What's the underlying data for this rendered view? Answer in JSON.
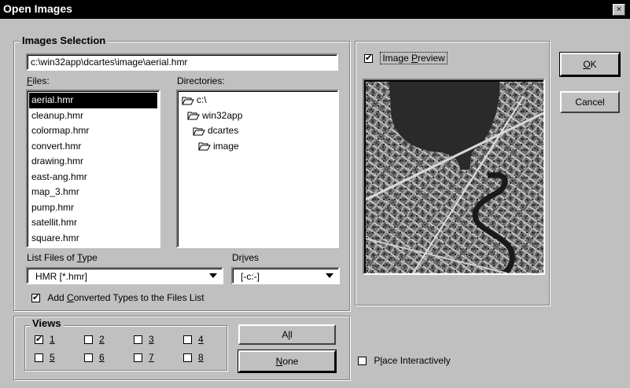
{
  "window": {
    "title": "Open Images",
    "close_glyph": "×"
  },
  "images_selection": {
    "legend": "Images Selection",
    "path_value": "c:\\win32app\\dcartes\\image\\aerial.hmr",
    "files_label": "Files:",
    "directories_label": "Directories:",
    "files": [
      "aerial.hmr",
      "cleanup.hmr",
      "colormap.hmr",
      "convert.hmr",
      "drawing.hmr",
      "east-ang.hmr",
      "map_3.hmr",
      "pump.hmr",
      "satellit.hmr",
      "square.hmr"
    ],
    "selected_file": "aerial.hmr",
    "directories": [
      "c:\\",
      "win32app",
      "dcartes",
      "image"
    ],
    "list_type_label": "List Files of Type",
    "list_type_value": "HMR [*.hmr]",
    "drives_label": "Drives",
    "drives_value": "[-c:-]",
    "add_converted_label": "Add Converted Types to the Files List",
    "add_converted_checked": true
  },
  "preview": {
    "label": "Image Preview",
    "checked": true
  },
  "buttons": {
    "ok": "OK",
    "cancel": "Cancel",
    "all": "All",
    "none": "None"
  },
  "views": {
    "legend": "Views",
    "items": [
      {
        "label": "1",
        "checked": true
      },
      {
        "label": "2",
        "checked": false
      },
      {
        "label": "3",
        "checked": false
      },
      {
        "label": "4",
        "checked": false
      },
      {
        "label": "5",
        "checked": false
      },
      {
        "label": "6",
        "checked": false
      },
      {
        "label": "7",
        "checked": false
      },
      {
        "label": "8",
        "checked": false
      }
    ]
  },
  "place_interactively": {
    "label": "Place Interactively",
    "checked": false
  },
  "icons": [
    "close-icon",
    "folder-open-icon",
    "dropdown-arrow-icon",
    "checkbox-icon"
  ]
}
